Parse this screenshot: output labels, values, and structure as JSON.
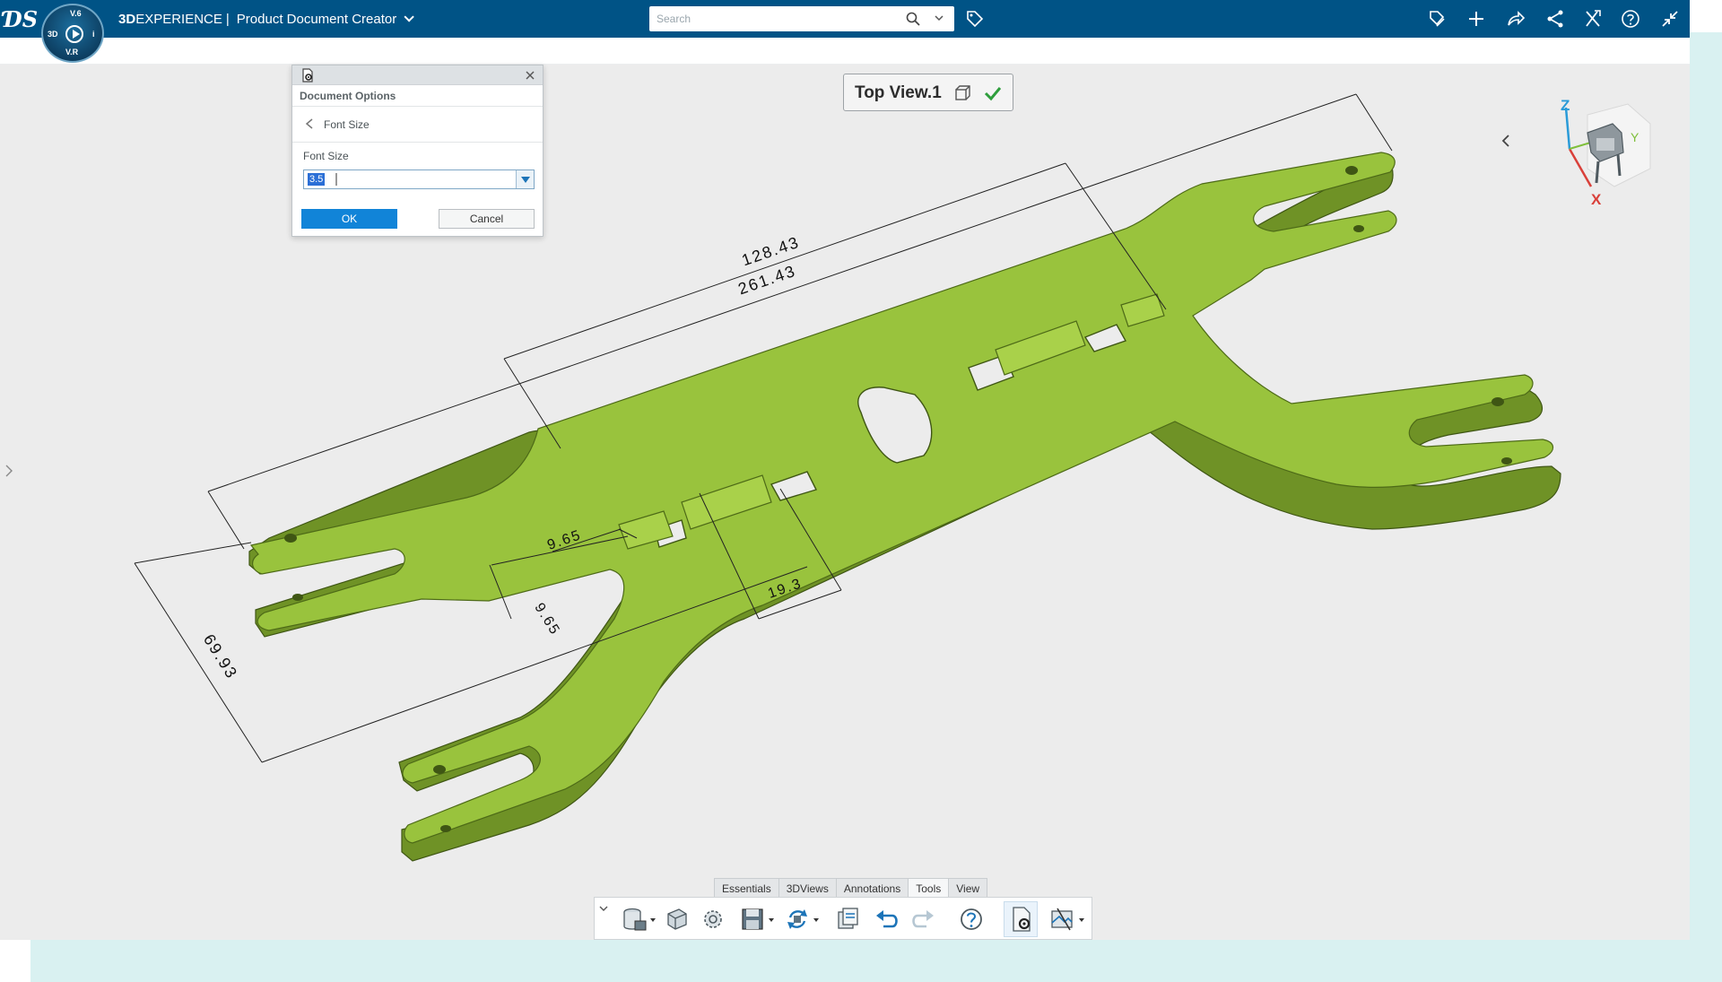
{
  "topbar": {
    "brand_bold": "3D",
    "brand_rest": "EXPERIENCE",
    "brand_sep": "|",
    "app_title": "Product Document Creator",
    "compass": {
      "top": "V.6",
      "left": "3D",
      "right": "i",
      "bottom": "V.R"
    },
    "search": {
      "placeholder": "Search"
    }
  },
  "icons": {
    "logo": "ds-logo-icon",
    "search": "search-icon",
    "tag": "tag-icon",
    "topbar_right": [
      "edit-tag-icon",
      "plus-icon",
      "share-arrow-icon",
      "share-icon",
      "tools-icon",
      "help-icon",
      "collapse-window-icon"
    ]
  },
  "dialog": {
    "title": "Document Options",
    "back_label": "Font Size",
    "field_label": "Font Size",
    "field_value": "3.5",
    "ok_label": "OK",
    "cancel_label": "Cancel"
  },
  "view": {
    "label": "Top View.1"
  },
  "dimensions": [
    "128.43",
    "261.43",
    "9.65",
    "9.65",
    "19.3",
    "69.93"
  ],
  "compass_axes": {
    "z": "Z",
    "y": "Y",
    "x": "X"
  },
  "toolbar": {
    "tabs": [
      "Essentials",
      "3DViews",
      "Annotations",
      "Tools",
      "View"
    ],
    "active_tab": "Tools"
  },
  "colors": {
    "topbar": "#005386",
    "part_fill": "#99c33d",
    "part_shadow": "#6f9226",
    "accent_blue": "#1184d8",
    "check_green": "#2e9e3c"
  }
}
